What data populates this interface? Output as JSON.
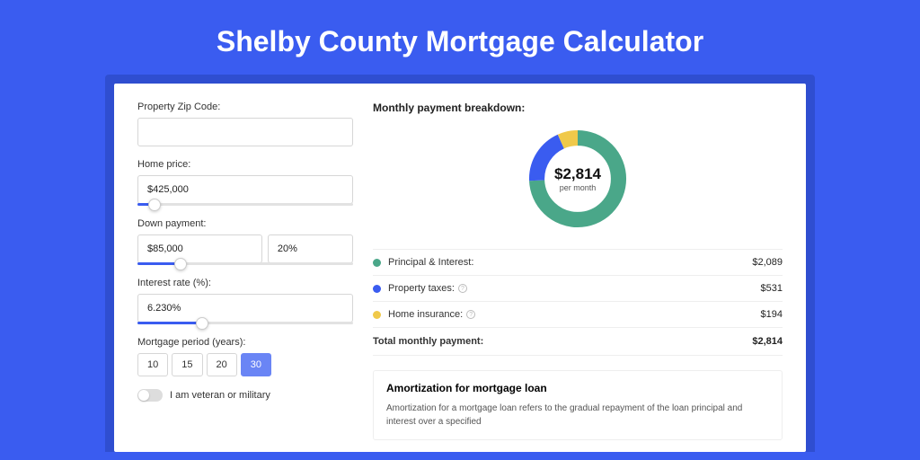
{
  "page": {
    "title": "Shelby County Mortgage Calculator"
  },
  "form": {
    "zip": {
      "label": "Property Zip Code:",
      "value": ""
    },
    "homePrice": {
      "label": "Home price:",
      "value": "$425,000",
      "sliderPct": 8
    },
    "downPayment": {
      "label": "Down payment:",
      "amount": "$85,000",
      "percent": "20%",
      "sliderPct": 20
    },
    "interestRate": {
      "label": "Interest rate (%):",
      "value": "6.230%",
      "sliderPct": 30
    },
    "period": {
      "label": "Mortgage period (years):",
      "options": [
        "10",
        "15",
        "20",
        "30"
      ],
      "selected": "30"
    },
    "veteran": {
      "label": "I am veteran or military",
      "checked": false
    }
  },
  "breakdown": {
    "title": "Monthly payment breakdown:",
    "centerAmount": "$2,814",
    "centerSub": "per month",
    "items": [
      {
        "label": "Principal & Interest:",
        "value": "$2,089",
        "color": "#4aa789",
        "hasInfo": false
      },
      {
        "label": "Property taxes:",
        "value": "$531",
        "color": "#3a5cf0",
        "hasInfo": true
      },
      {
        "label": "Home insurance:",
        "value": "$194",
        "color": "#f0c94a",
        "hasInfo": true
      }
    ],
    "totalLabel": "Total monthly payment:",
    "totalValue": "$2,814"
  },
  "amortization": {
    "title": "Amortization for mortgage loan",
    "text": "Amortization for a mortgage loan refers to the gradual repayment of the loan principal and interest over a specified"
  },
  "chart_data": {
    "type": "pie",
    "title": "Monthly payment breakdown",
    "series": [
      {
        "name": "Principal & Interest",
        "value": 2089,
        "color": "#4aa789"
      },
      {
        "name": "Property taxes",
        "value": 531,
        "color": "#3a5cf0"
      },
      {
        "name": "Home insurance",
        "value": 194,
        "color": "#f0c94a"
      }
    ],
    "total": 2814,
    "center_label": "$2,814",
    "center_sub": "per month"
  }
}
